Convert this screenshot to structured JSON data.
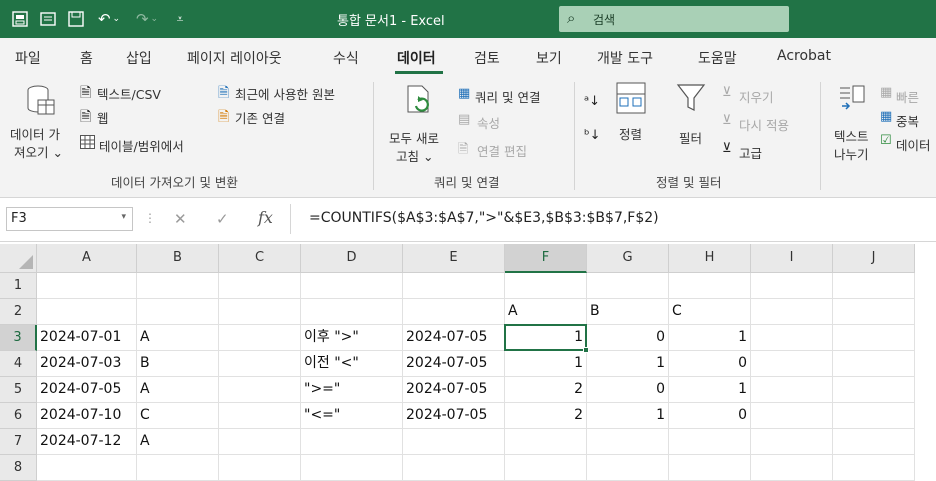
{
  "titlebar": {
    "title": "통합 문서1  -  Excel",
    "search_label": "검색"
  },
  "tabs": [
    "파일",
    "홈",
    "삽입",
    "페이지 레이아웃",
    "수식",
    "데이터",
    "검토",
    "보기",
    "개발 도구",
    "도움말",
    "Acrobat"
  ],
  "active_tab": "데이터",
  "ribbon": {
    "get_data": {
      "line1": "데이터 가",
      "line2": "져오기 ⌄"
    },
    "text_csv": "텍스트/CSV",
    "web": "웹",
    "table_range": "테이블/범위에서",
    "recent_sources": "최근에 사용한 원본",
    "existing_connections": "기존 연결",
    "group_get_transform": "데이터 가져오기 및 변환",
    "refresh_all": {
      "line1": "모두 새로",
      "line2": "고침 ⌄"
    },
    "queries_connections": "쿼리 및 연결",
    "properties": "속성",
    "edit_links": "연결 편집",
    "group_queries": "쿼리 및 연결",
    "sort": "정렬",
    "filter": "필터",
    "clear": "지우기",
    "reapply": "다시 적용",
    "advanced": "고급",
    "group_sort_filter": "정렬 및 필터",
    "text_to_columns": {
      "line1": "텍스트",
      "line2": "나누기"
    },
    "flash_fill": "빠른",
    "remove_duplicates": "중복",
    "data_validation": "데이터"
  },
  "formula_bar": {
    "name_box": "F3",
    "formula": "=COUNTIFS($A$3:$A$7,\">\"&$E3,$B$3:$B$7,F$2)"
  },
  "columns": [
    "A",
    "B",
    "C",
    "D",
    "E",
    "F",
    "G",
    "H",
    "I",
    "J"
  ],
  "rows": [
    "1",
    "2",
    "3",
    "4",
    "5",
    "6",
    "7",
    "8"
  ],
  "cells": {
    "F2": "A",
    "G2": "B",
    "H2": "C",
    "A3": "2024-07-01",
    "B3": "A",
    "D3": "이후 \">\"",
    "E3": "2024-07-05",
    "F3": "1",
    "G3": "0",
    "H3": "1",
    "A4": "2024-07-03",
    "B4": "B",
    "D4": "이전 \"<\"",
    "E4": "2024-07-05",
    "F4": "1",
    "G4": "1",
    "H4": "0",
    "A5": "2024-07-05",
    "B5": "A",
    "D5": "\">=\"",
    "E5": "2024-07-05",
    "F5": "2",
    "G5": "0",
    "H5": "1",
    "A6": "2024-07-10",
    "B6": "C",
    "D6": "\"<=\"",
    "E6": "2024-07-05",
    "F6": "2",
    "G6": "1",
    "H6": "0",
    "A7": "2024-07-12",
    "B7": "A"
  },
  "selected_cell": "F3",
  "colors": {
    "brand": "#217346",
    "ribbon_bg": "#f3f3f3",
    "search_bg": "#a9d0b6"
  }
}
